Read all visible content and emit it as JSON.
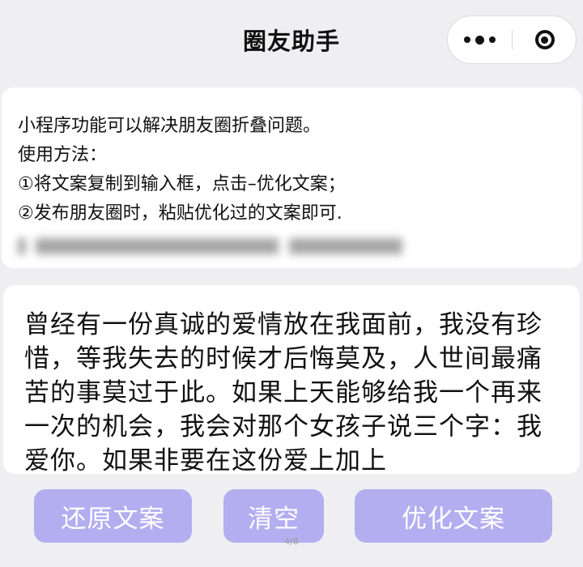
{
  "header": {
    "title": "圈友助手",
    "more_icon": "more-dots-icon",
    "close_icon": "target-circle-icon"
  },
  "info": {
    "line1": "小程序功能可以解决朋友圈折叠问题。",
    "line2": "使用方法：",
    "line3": "①将文案复制到输入框，点击–优化文案；",
    "line4": "②发布朋友圈时，粘贴优化过的文案即可."
  },
  "editor": {
    "content": "曾经有一份真诚的爱情放在我面前，我没有珍惜，等我失去的时候才后悔莫及，人世间最痛苦的事莫过于此。如果上天能够给我一个再来一次的机会，我会对那个女孩子说三个字：我爱你。如果非要在这份爱上加上"
  },
  "buttons": {
    "restore": "还原文案",
    "clear": "清空",
    "optimize": "优化文案"
  },
  "pager": "4/8",
  "colors": {
    "button_bg": "#b3aef0",
    "page_bg": "#efeff2",
    "card_bg": "#ffffff"
  }
}
